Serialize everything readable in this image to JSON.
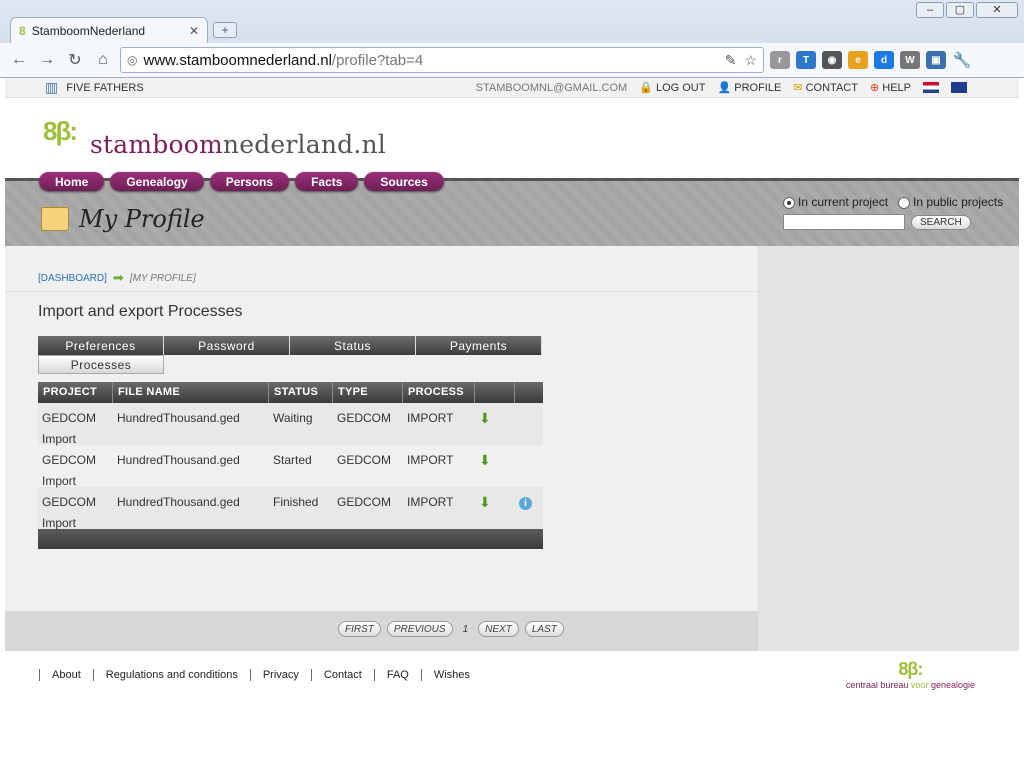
{
  "browser": {
    "tab_title": "StamboomNederland",
    "url_host": "www.stamboomnederland.nl",
    "url_path": "/profile?tab=4"
  },
  "topbar": {
    "project": "FIVE FATHERS",
    "email": "STAMBOOMNL@GMAIL.COM",
    "logout": "LOG OUT",
    "profile": "PROFILE",
    "contact": "CONTACT",
    "help": "HELP"
  },
  "logo": {
    "brand": "stamboom",
    "rest": "nederland.nl"
  },
  "menu": [
    "Home",
    "Genealogy",
    "Persons",
    "Facts",
    "Sources"
  ],
  "page_title": "My Profile",
  "search": {
    "radio_current": "In current project",
    "radio_public": "In public projects",
    "button": "SEARCH"
  },
  "breadcrumb": {
    "dashboard": "[DASHBOARD]",
    "current": "[MY PROFILE]"
  },
  "section_title": "Import and export Processes",
  "tabs": [
    "Preferences",
    "Password",
    "Status",
    "Payments",
    "Processes"
  ],
  "grid": {
    "headers": [
      "PROJECT",
      "FILE NAME",
      "STATUS",
      "TYPE",
      "PROCESS"
    ],
    "rows": [
      {
        "project": "GEDCOM Import",
        "file": "HundredThousand.ged",
        "status": "Waiting",
        "type": "GEDCOM",
        "process": "IMPORT"
      },
      {
        "project": "GEDCOM Import",
        "file": "HundredThousand.ged",
        "status": "Started",
        "type": "GEDCOM",
        "process": "IMPORT"
      },
      {
        "project": "GEDCOM Import",
        "file": "HundredThousand.ged",
        "status": "Finished",
        "type": "GEDCOM",
        "process": "IMPORT"
      }
    ]
  },
  "pager": {
    "first": "FIRST",
    "previous": "PREVIOUS",
    "page": "1",
    "next": "NEXT",
    "last": "LAST"
  },
  "footer": {
    "links": [
      "About",
      "Regulations and conditions",
      "Privacy",
      "Contact",
      "FAQ",
      "Wishes"
    ],
    "logo_a": "centraal bureau",
    "logo_b": "voor",
    "logo_c": "genealogie"
  }
}
